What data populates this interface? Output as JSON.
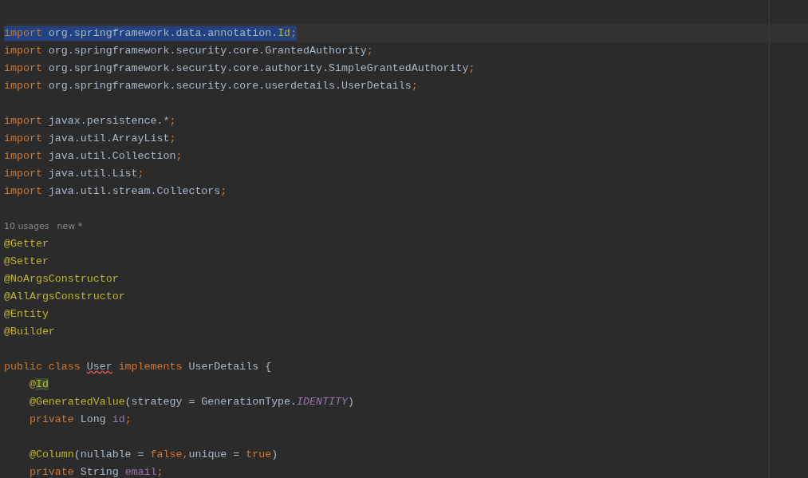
{
  "editor": {
    "lines": [
      {
        "kind": "blank"
      },
      {
        "kind": "blank"
      },
      {
        "kind": "code",
        "selected": true,
        "tokens": [
          {
            "kind": "kw",
            "text": "import "
          },
          {
            "kind": "text",
            "text": "org.springframework.data.annotation."
          },
          {
            "kind": "ann",
            "text": "Id"
          },
          {
            "kind": "punct",
            "text": ";"
          }
        ]
      },
      {
        "kind": "code",
        "selected": false,
        "tokens": [
          {
            "kind": "kw",
            "text": "import "
          },
          {
            "kind": "text",
            "text": "org.springframework.security.core.GrantedAuthority"
          },
          {
            "kind": "punct",
            "text": ";"
          }
        ]
      },
      {
        "kind": "code",
        "selected": false,
        "tokens": [
          {
            "kind": "kw",
            "text": "import "
          },
          {
            "kind": "text",
            "text": "org.springframework.security.core.authority.SimpleGrantedAuthority"
          },
          {
            "kind": "punct",
            "text": ";"
          }
        ]
      },
      {
        "kind": "code",
        "selected": false,
        "tokens": [
          {
            "kind": "kw",
            "text": "import "
          },
          {
            "kind": "text",
            "text": "org.springframework.security.core.userdetails.UserDetails"
          },
          {
            "kind": "punct",
            "text": ";"
          }
        ]
      },
      {
        "kind": "blank"
      },
      {
        "kind": "code",
        "selected": false,
        "tokens": [
          {
            "kind": "kw",
            "text": "import "
          },
          {
            "kind": "text",
            "text": "javax.persistence.*"
          },
          {
            "kind": "punct",
            "text": ";"
          }
        ]
      },
      {
        "kind": "code",
        "selected": false,
        "tokens": [
          {
            "kind": "kw",
            "text": "import "
          },
          {
            "kind": "text",
            "text": "java.util.ArrayList"
          },
          {
            "kind": "punct",
            "text": ";"
          }
        ]
      },
      {
        "kind": "code",
        "selected": false,
        "tokens": [
          {
            "kind": "kw",
            "text": "import "
          },
          {
            "kind": "text",
            "text": "java.util.Collection"
          },
          {
            "kind": "punct",
            "text": ";"
          }
        ]
      },
      {
        "kind": "code",
        "selected": false,
        "tokens": [
          {
            "kind": "kw",
            "text": "import "
          },
          {
            "kind": "text",
            "text": "java.util.List"
          },
          {
            "kind": "punct",
            "text": ";"
          }
        ]
      },
      {
        "kind": "code",
        "selected": false,
        "tokens": [
          {
            "kind": "kw",
            "text": "import "
          },
          {
            "kind": "text",
            "text": "java.util.stream.Collectors"
          },
          {
            "kind": "punct",
            "text": ";"
          }
        ]
      },
      {
        "kind": "blank"
      },
      {
        "kind": "hint",
        "texts": [
          "10 usages",
          "new *"
        ]
      },
      {
        "kind": "code",
        "selected": false,
        "tokens": [
          {
            "kind": "ann",
            "text": "@Getter"
          }
        ]
      },
      {
        "kind": "code",
        "selected": false,
        "tokens": [
          {
            "kind": "ann",
            "text": "@Setter"
          }
        ]
      },
      {
        "kind": "code",
        "selected": false,
        "tokens": [
          {
            "kind": "ann",
            "text": "@NoArgsConstructor"
          }
        ]
      },
      {
        "kind": "code",
        "selected": false,
        "tokens": [
          {
            "kind": "ann",
            "text": "@AllArgsConstructor"
          }
        ]
      },
      {
        "kind": "code",
        "selected": false,
        "tokens": [
          {
            "kind": "ann",
            "text": "@Entity"
          }
        ]
      },
      {
        "kind": "code",
        "selected": false,
        "tokens": [
          {
            "kind": "ann",
            "text": "@Builder"
          }
        ]
      },
      {
        "kind": "blank"
      },
      {
        "kind": "code",
        "selected": false,
        "tokens": [
          {
            "kind": "kw",
            "text": "public class "
          },
          {
            "kind": "error",
            "text": "User"
          },
          {
            "kind": "kw",
            "text": " implements "
          },
          {
            "kind": "text",
            "text": "UserDetails {"
          }
        ]
      },
      {
        "kind": "code",
        "selected": false,
        "tokens": [
          {
            "kind": "ann",
            "text": "    @"
          },
          {
            "kind": "match",
            "text": "Id"
          }
        ]
      },
      {
        "kind": "code",
        "selected": false,
        "tokens": [
          {
            "kind": "ann",
            "text": "    @GeneratedValue"
          },
          {
            "kind": "text",
            "text": "(strategy = GenerationType."
          },
          {
            "kind": "const",
            "text": "IDENTITY"
          },
          {
            "kind": "text",
            "text": ")"
          }
        ]
      },
      {
        "kind": "code",
        "selected": false,
        "tokens": [
          {
            "kind": "kw",
            "text": "    private "
          },
          {
            "kind": "text",
            "text": "Long "
          },
          {
            "kind": "field",
            "text": "id"
          },
          {
            "kind": "punct",
            "text": ";"
          }
        ]
      },
      {
        "kind": "blank"
      },
      {
        "kind": "code",
        "selected": false,
        "tokens": [
          {
            "kind": "ann",
            "text": "    @Column"
          },
          {
            "kind": "text",
            "text": "(nullable = "
          },
          {
            "kind": "kw",
            "text": "false"
          },
          {
            "kind": "punct",
            "text": ","
          },
          {
            "kind": "text",
            "text": "unique = "
          },
          {
            "kind": "kw",
            "text": "true"
          },
          {
            "kind": "text",
            "text": ")"
          }
        ]
      },
      {
        "kind": "code",
        "selected": false,
        "tokens": [
          {
            "kind": "kw",
            "text": "    private "
          },
          {
            "kind": "text",
            "text": "String "
          },
          {
            "kind": "field",
            "text": "email"
          },
          {
            "kind": "punct",
            "text": ";"
          }
        ]
      }
    ]
  }
}
